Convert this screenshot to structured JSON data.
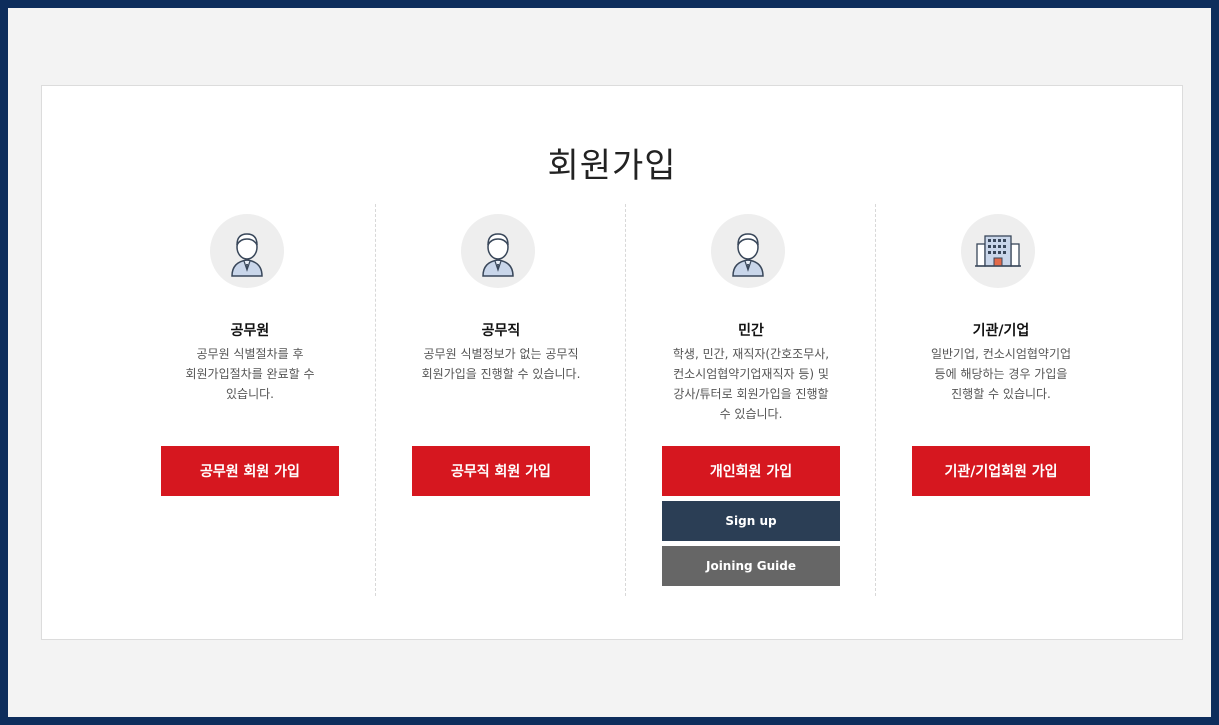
{
  "page": {
    "title": "회원가입"
  },
  "columns": [
    {
      "icon": "person-icon",
      "title": "공무원",
      "desc": "공무원 식별절차를 후\n회원가입절차를 완료할 수\n있습니다.",
      "button": "공무원 회원 가입"
    },
    {
      "icon": "person-icon",
      "title": "공무직",
      "desc": "공무원 식별정보가 없는 공무직\n회원가입을 진행할 수 있습니다.",
      "button": "공무직 회원 가입"
    },
    {
      "icon": "person-icon",
      "title": "민간",
      "desc": "학생, 민간, 재직자(간호조무사,\n컨소시엄협약기업재직자 등) 및\n강사/튜터로 회원가입을 진행할\n수 있습니다.",
      "button": "개인회원 가입",
      "extra_buttons": [
        "Sign up",
        "Joining Guide"
      ]
    },
    {
      "icon": "building-icon",
      "title": "기관/기업",
      "desc": "일반기업, 컨소시엄협약기업\n등에 해당하는 경우 가입을\n진행할 수 있습니다.",
      "button": "기관/기업회원 가입"
    }
  ],
  "colors": {
    "frame": "#0d2d5c",
    "primary_button": "#d6171f",
    "signup_button": "#2b3e55",
    "guide_button": "#666666"
  }
}
